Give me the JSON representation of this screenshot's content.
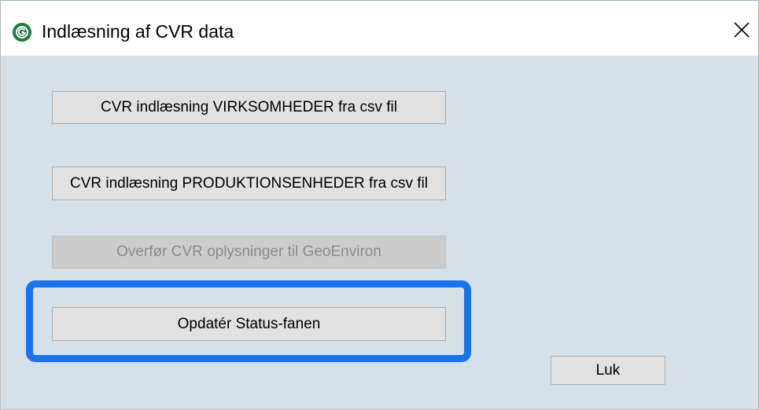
{
  "window": {
    "title": "Indlæsning af CVR data",
    "app_icon": "geoenviron-logo-icon",
    "close_icon": "close-icon"
  },
  "buttons": {
    "virksomheder": "CVR indlæsning VIRKSOMHEDER fra csv fil",
    "produktionsenheder": "CVR indlæsning PRODUKTIONSENHEDER fra csv fil",
    "overfor": "Overfør CVR oplysninger til GeoEnviron",
    "opdater_status": "Opdatér Status-fanen",
    "luk": "Luk"
  },
  "colors": {
    "highlight": "#1a73e8",
    "client_background": "#d6e0e8",
    "icon_green": "#1f7a3c"
  }
}
